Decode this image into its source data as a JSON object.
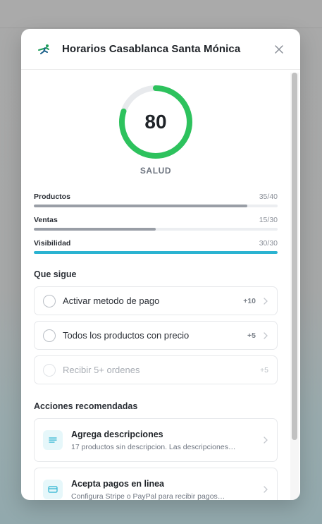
{
  "modal": {
    "title": "Horarios Casablanca Santa Mónica",
    "close_icon": "close-icon",
    "logo_icon": "runner-logo-icon",
    "accent_color": "#2ab3d1"
  },
  "health": {
    "score": "80",
    "score_fraction": 0.8,
    "label": "SALUD",
    "ring_color": "#2dc25d"
  },
  "metrics": [
    {
      "name": "Productos",
      "score": "35/40",
      "fraction": 0.875,
      "color": "#999ea6"
    },
    {
      "name": "Ventas",
      "score": "15/30",
      "fraction": 0.5,
      "color": "#999ea6"
    },
    {
      "name": "Visibilidad",
      "score": "30/30",
      "fraction": 1.0,
      "color": "#2ab3d1"
    }
  ],
  "next_steps": {
    "title": "Que sigue",
    "items": [
      {
        "label": "Activar metodo de pago",
        "points": "+10"
      },
      {
        "label": "Todos los productos con precio",
        "points": "+5"
      },
      {
        "label": "Recibir 5+ ordenes",
        "points": "+5"
      }
    ]
  },
  "recommended": {
    "title": "Acciones recomendadas",
    "items": [
      {
        "title": "Agrega descripciones",
        "description": "17 productos sin descripcion. Las descripciones…",
        "icon": "text-lines-icon"
      },
      {
        "title": "Acepta pagos en linea",
        "description": "Configura Stripe o PayPal para recibir pagos…",
        "icon": "credit-card-icon"
      }
    ]
  }
}
